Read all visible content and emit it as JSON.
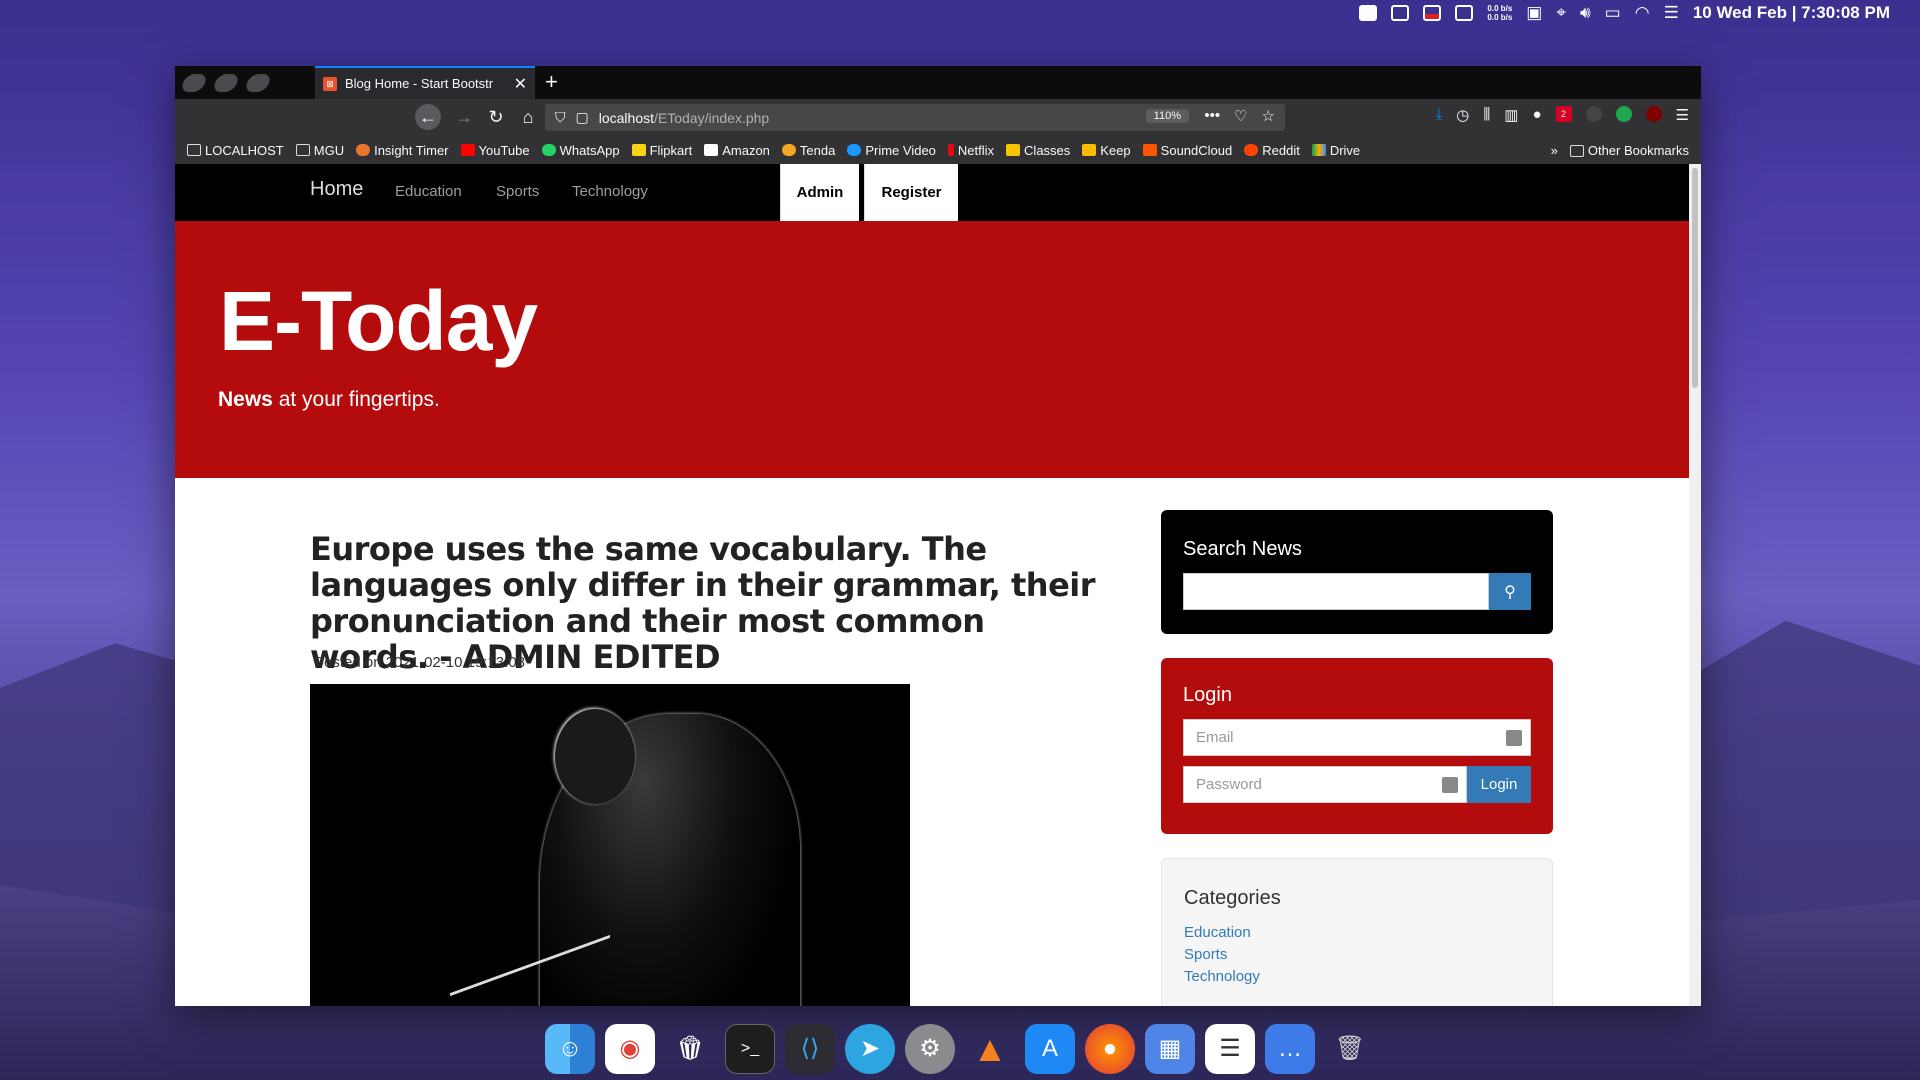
{
  "menubar": {
    "netspeed_up": "0.0 b/s",
    "netspeed_down": "0.0 b/s",
    "datetime": "10 Wed Feb | 7:30:08 PM"
  },
  "browser": {
    "tab_title": "Blog Home - Start Bootstr",
    "url_host": "localhost",
    "url_path": "/EToday/index.php",
    "zoom": "110%",
    "ext_badge": "2",
    "bookmarks": [
      "LOCALHOST",
      "MGU",
      "Insight Timer",
      "YouTube",
      "WhatsApp",
      "Flipkart",
      "Amazon",
      "Tenda",
      "Prime Video",
      "Netflix",
      "Classes",
      "Keep",
      "SoundCloud",
      "Reddit",
      "Drive"
    ],
    "other_bookmarks": "Other Bookmarks"
  },
  "site": {
    "nav": {
      "brand": "Home",
      "links": [
        "Education",
        "Sports",
        "Technology"
      ],
      "admin": "Admin",
      "register": "Register"
    },
    "hero": {
      "title": "E-Today",
      "tagline_bold": "News",
      "tagline_rest": " at your fingertips."
    },
    "post": {
      "title": "Europe uses the same vocabulary. The languages only differ in their grammar, their pronunciation and their most common words. - ADMIN EDITED",
      "posted": "Posted on 2021-02-10 19:13:08"
    },
    "search": {
      "heading": "Search News",
      "placeholder": ""
    },
    "login": {
      "heading": "Login",
      "email_placeholder": "Email",
      "password_placeholder": "Password",
      "button": "Login"
    },
    "categories": {
      "heading": "Categories",
      "items": [
        "Education",
        "Sports",
        "Technology"
      ]
    }
  },
  "dock": [
    "Finder",
    "Chrome",
    "Popcorn Time",
    "Terminal",
    "VS Code",
    "Telegram",
    "System Preferences",
    "VLC",
    "App Store",
    "Firefox",
    "Launchpad",
    "Reminders",
    "Messages",
    "Trash"
  ]
}
